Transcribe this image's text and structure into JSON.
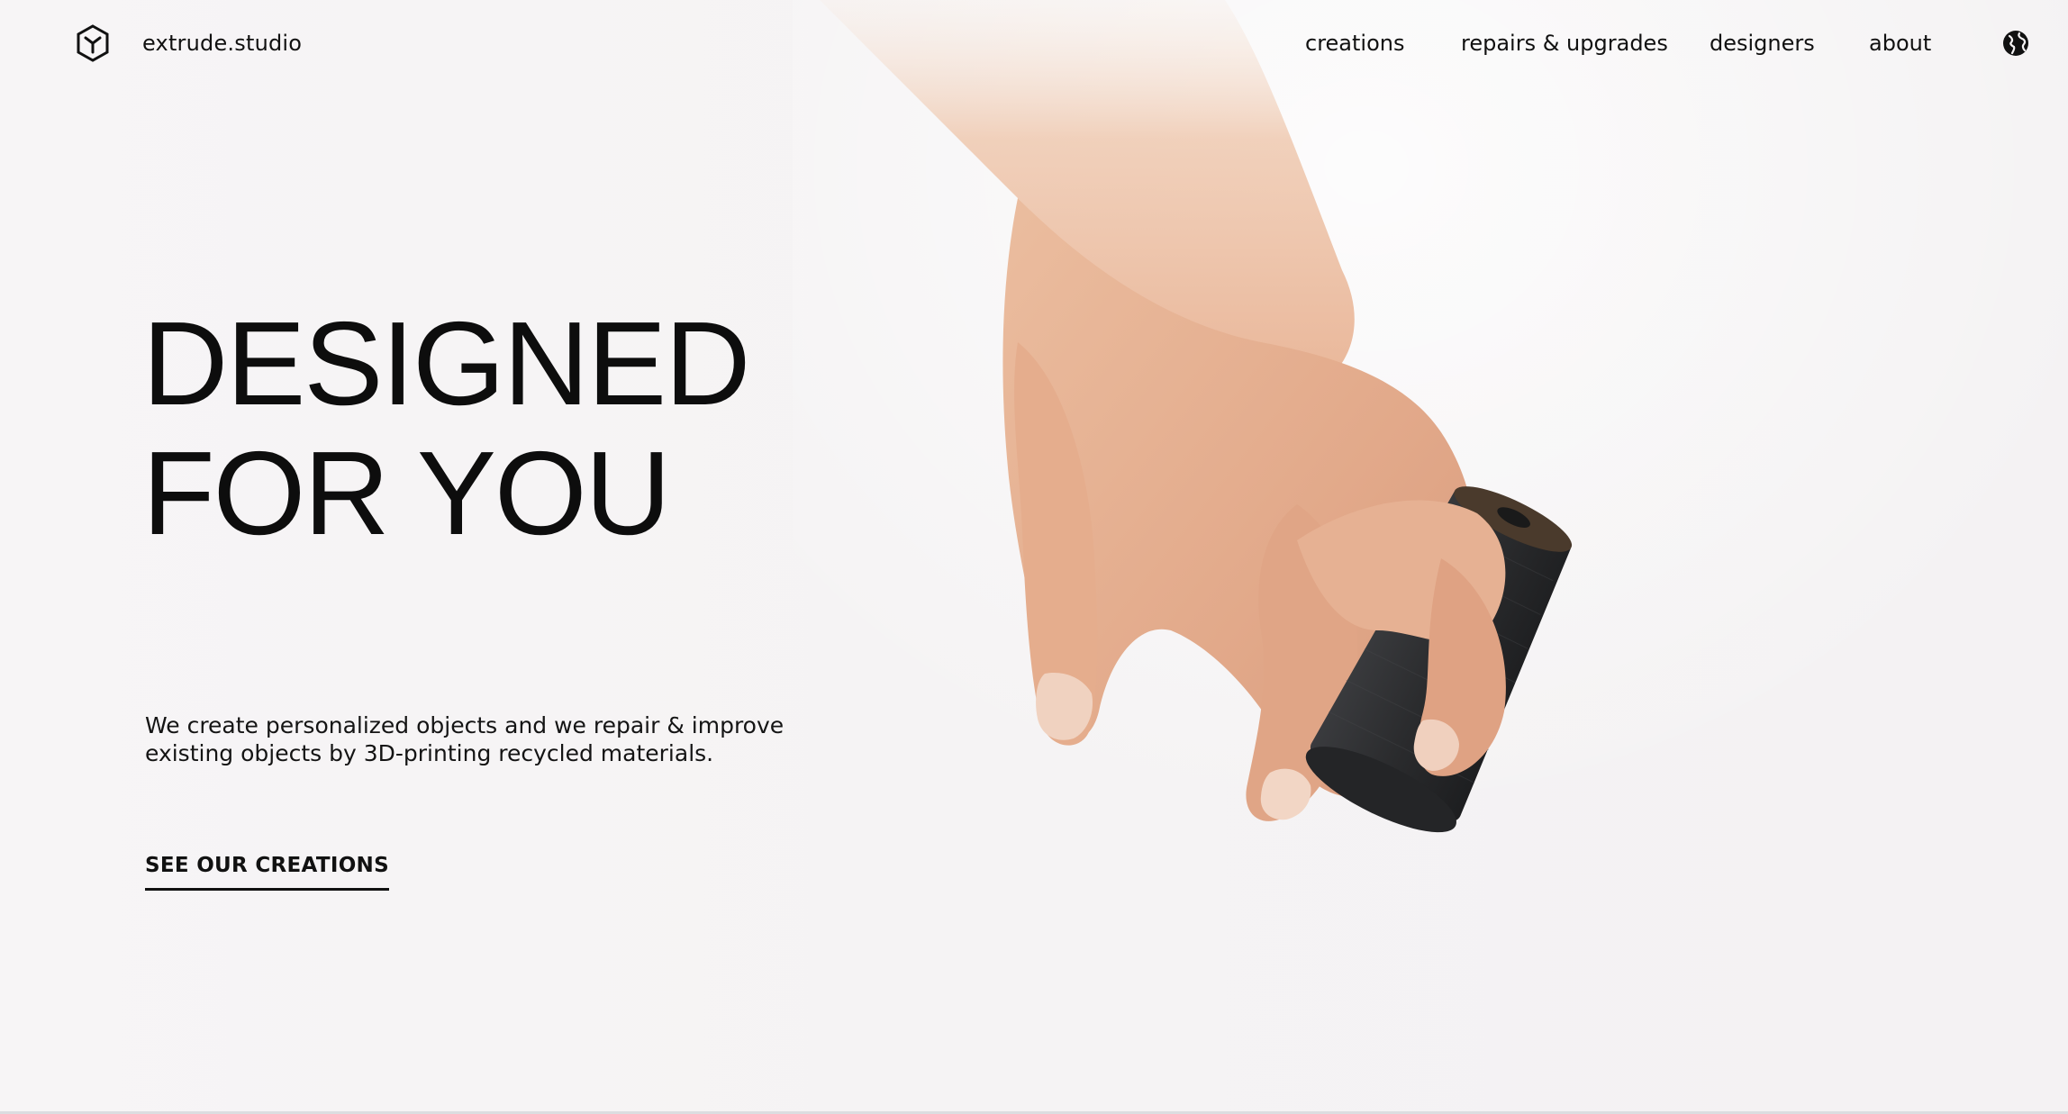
{
  "brand": {
    "name": "extrude.studio",
    "icon": "hexagon-logo-icon"
  },
  "nav": {
    "items": [
      {
        "label": "creations"
      },
      {
        "label": "repairs & upgrades"
      },
      {
        "label": "designers"
      },
      {
        "label": "about"
      }
    ],
    "language_icon": "globe-icon"
  },
  "hero": {
    "title_line1": "DESIGNED",
    "title_line2": "FOR YOU",
    "description_line1": "We create personalized objects and we repair & improve",
    "description_line2": "existing objects by 3D-printing recycled materials.",
    "cta_label": "SEE OUR CREATIONS",
    "image": "hand-holding-3d-printed-part"
  },
  "colors": {
    "background": "#f6f4f5",
    "text": "#111111",
    "skin": "#e7b99a",
    "object": "#2e2f31"
  }
}
